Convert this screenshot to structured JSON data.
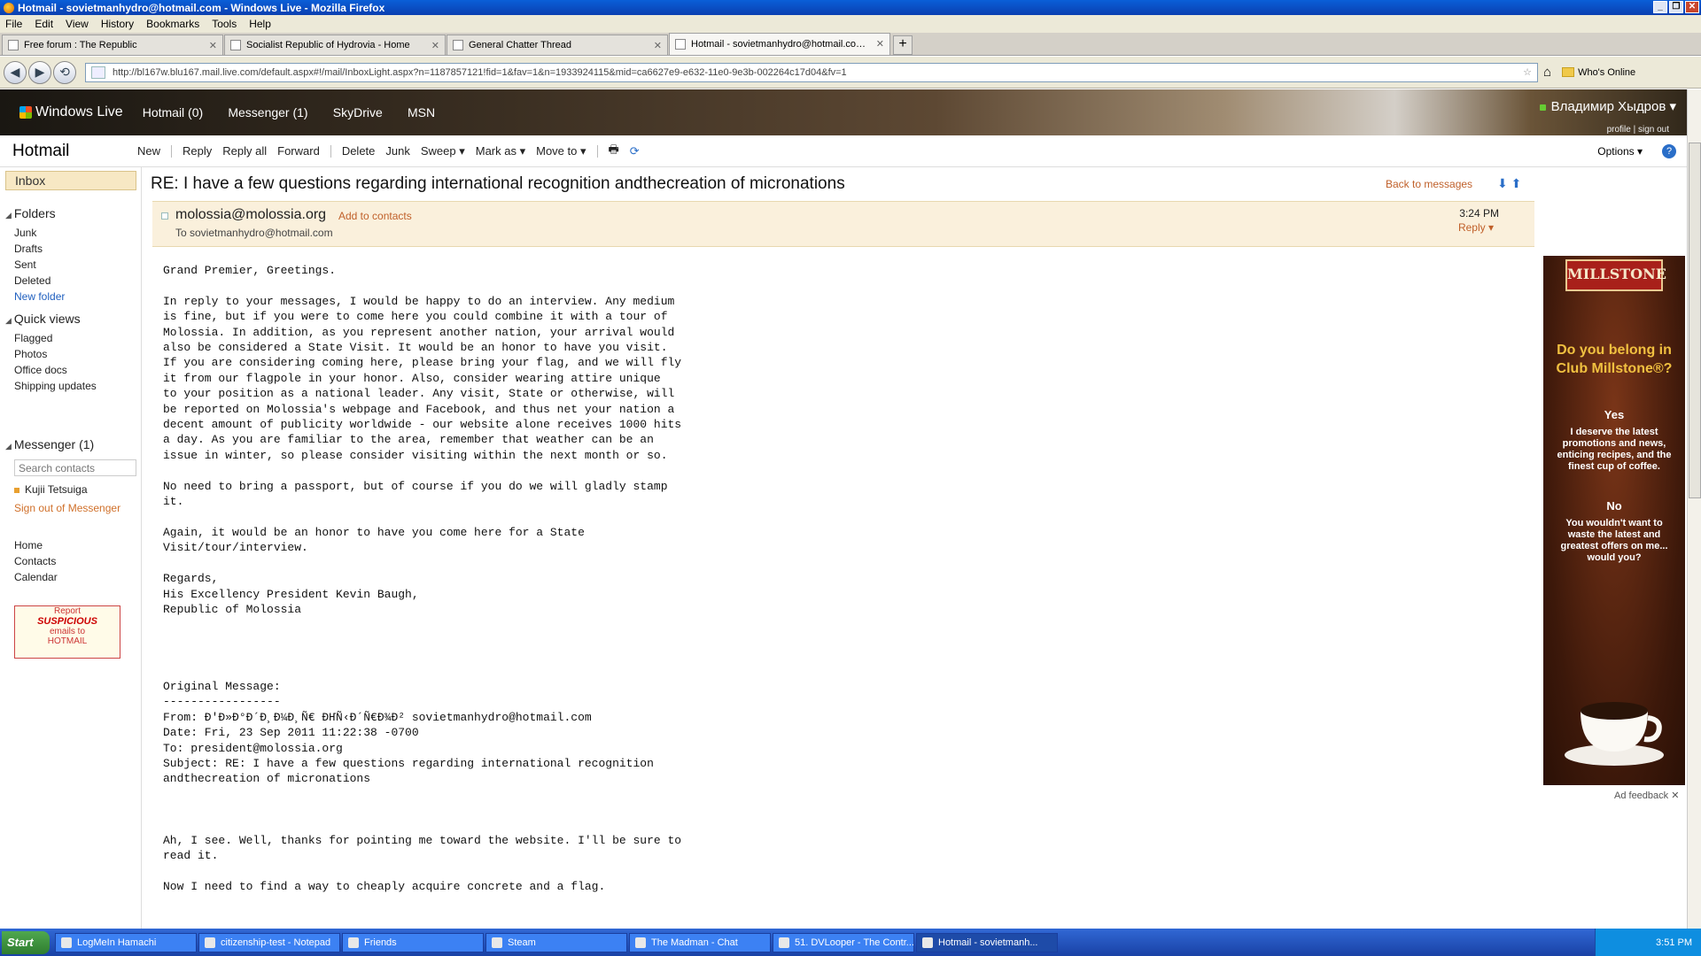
{
  "browser": {
    "window_title": "Hotmail - sovietmanhydro@hotmail.com - Windows Live - Mozilla Firefox",
    "menu": [
      "File",
      "Edit",
      "View",
      "History",
      "Bookmarks",
      "Tools",
      "Help"
    ],
    "tabs": [
      {
        "label": "Free forum : The Republic",
        "active": false
      },
      {
        "label": "Socialist Republic of Hydrovia - Home",
        "active": false
      },
      {
        "label": "General Chatter Thread",
        "active": false
      },
      {
        "label": "Hotmail - sovietmanhydro@hotmail.com - ...",
        "active": true
      }
    ],
    "url": "http://bl167w.blu167.mail.live.com/default.aspx#!/mail/InboxLight.aspx?n=1187857121!fid=1&fav=1&n=1933924115&mid=ca6627e9-e632-11e0-9e3b-002264c17d04&fv=1",
    "bookmark": "Who's Online"
  },
  "live": {
    "brand": "Windows Live",
    "nav": [
      "Hotmail (0)",
      "Messenger (1)",
      "SkyDrive",
      "MSN"
    ],
    "user": "Владимир Хыдров",
    "user_links": "profile | sign out"
  },
  "toolbar": {
    "brand": "Hotmail",
    "items": [
      "New",
      "Reply",
      "Reply all",
      "Forward",
      "Delete",
      "Junk",
      "Sweep ▾",
      "Mark as ▾",
      "Move to ▾"
    ],
    "options": "Options ▾"
  },
  "sidebar": {
    "inbox": "Inbox",
    "folders_title": "Folders",
    "folders": [
      "Junk",
      "Drafts",
      "Sent",
      "Deleted"
    ],
    "new_folder": "New folder",
    "quick_views_title": "Quick views",
    "quick_views": [
      "Flagged",
      "Photos",
      "Office docs",
      "Shipping updates"
    ],
    "messenger_title": "Messenger (1)",
    "search_placeholder": "Search contacts",
    "contact": "Kujii Tetsuiga",
    "sign_out": "Sign out of Messenger",
    "bottom": [
      "Home",
      "Contacts",
      "Calendar"
    ],
    "report_ad": {
      "line1": "Report",
      "line2": "SUSPICIOUS",
      "line3": "emails to",
      "line4": "HOTMAIL"
    }
  },
  "message": {
    "subject": "RE: I have a few questions regarding international recognition andthecreation of micronations",
    "back": "Back to messages",
    "from": "molossia@molossia.org",
    "add_contacts": "Add to contacts",
    "to": "To sovietmanhydro@hotmail.com",
    "time": "3:24 PM",
    "reply": "Reply",
    "body": "Grand Premier, Greetings.\n\nIn reply to your messages, I would be happy to do an interview. Any medium\nis fine, but if you were to come here you could combine it with a tour of\nMolossia. In addition, as you represent another nation, your arrival would\nalso be considered a State Visit. It would be an honor to have you visit.\nIf you are considering coming here, please bring your flag, and we will fly\nit from our flagpole in your honor. Also, consider wearing attire unique\nto your position as a national leader. Any visit, State or otherwise, will\nbe reported on Molossia's webpage and Facebook, and thus net your nation a\ndecent amount of publicity worldwide - our website alone receives 1000 hits\na day. As you are familiar to the area, remember that weather can be an\nissue in winter, so please consider visiting within the next month or so.\n\nNo need to bring a passport, but of course if you do we will gladly stamp\nit.\n\nAgain, it would be an honor to have you come here for a State\nVisit/tour/interview.\n\nRegards,\nHis Excellency President Kevin Baugh,\nRepublic of Molossia\n\n\n\n\nOriginal Message:\n-----------------\nFrom: Ð'Ð»Ð°Ð´Ð¸Ð¼Ð¸Ñ€ ÐҤÑ‹Ð´Ñ€Ð¾Ð² sovietmanhydro@hotmail.com\nDate: Fri, 23 Sep 2011 11:22:38 -0700\nTo: president@molossia.org\nSubject: RE: I have a few questions regarding international recognition\nandthecreation of micronations\n\n\n\nAh, I see. Well, thanks for pointing me toward the website. I'll be sure to\nread it.\n\nNow I need to find a way to cheaply acquire concrete and a flag."
  },
  "ad": {
    "logo": "MILLSTONE",
    "question": "Do you belong in Club Millstone®?",
    "yes": "Yes",
    "yes_text": "I deserve the latest promotions and news, enticing recipes, and the finest cup of coffee.",
    "no": "No",
    "no_text": "You wouldn't want to waste the latest and greatest offers on me... would you?",
    "feedback": "Ad feedback"
  },
  "taskbar": {
    "start": "Start",
    "tasks": [
      "LogMeIn Hamachi",
      "citizenship-test - Notepad",
      "Friends",
      "Steam",
      "The Madman - Chat",
      "51. DVLooper - The Contr...",
      "Hotmail - sovietmanh..."
    ],
    "clock": "3:51 PM"
  },
  "colors": {
    "accent_link": "#c0602a",
    "blue_link": "#1f5fbf",
    "titlebar": "#0a4fc8"
  }
}
